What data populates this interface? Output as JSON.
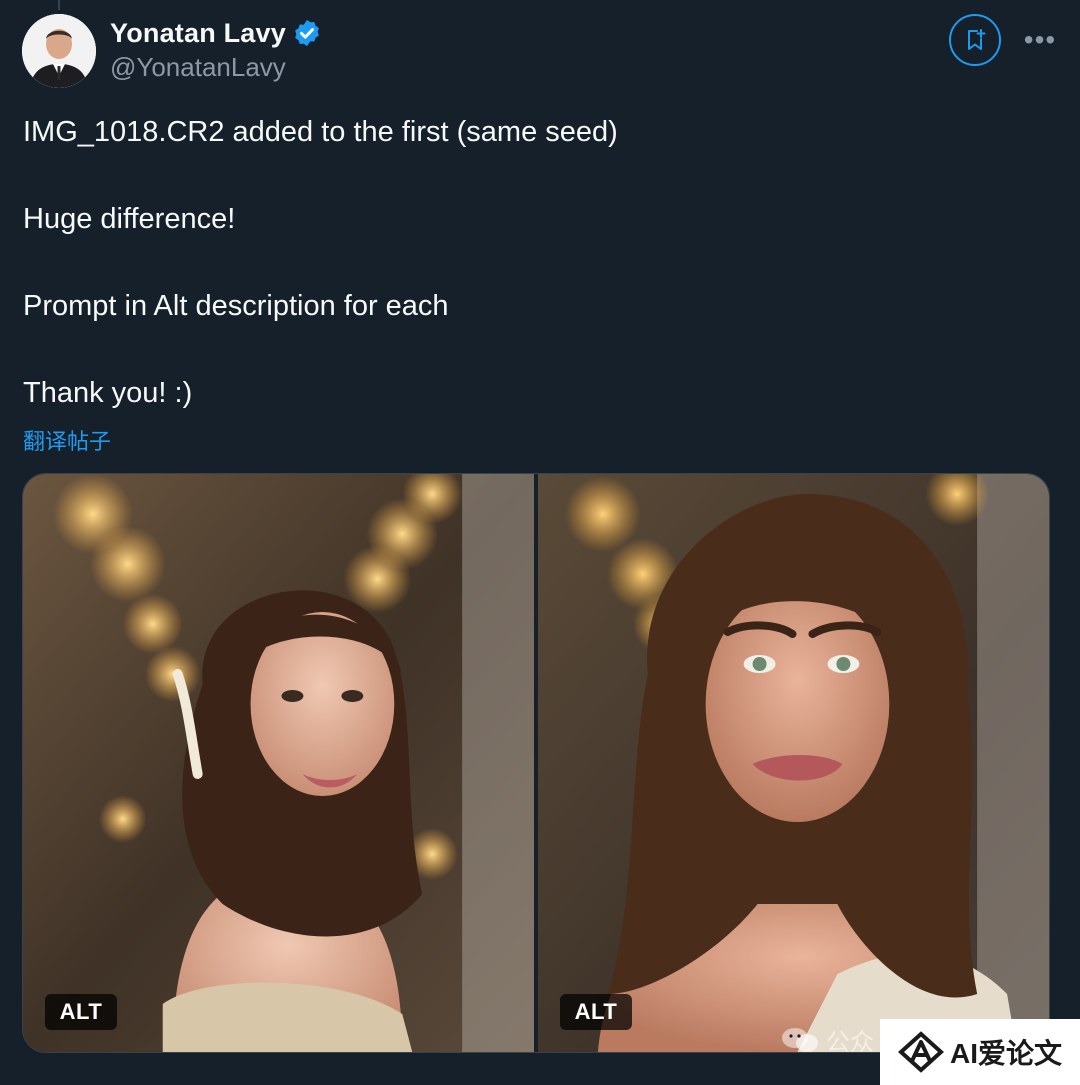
{
  "author": {
    "display_name": "Yonatan Lavy",
    "handle": "@YonatanLavy",
    "verified": true
  },
  "actions": {
    "subscribe_icon": "bookmark-plus-icon",
    "more_label": "•••"
  },
  "tweet": {
    "lines": [
      "IMG_1018.CR2 added to the first (same seed)",
      "Huge difference!",
      "Prompt in Alt description for each",
      "Thank you! :)"
    ],
    "translate_link": "翻译帖子"
  },
  "media": [
    {
      "alt_badge": "ALT"
    },
    {
      "alt_badge": "ALT"
    }
  ],
  "watermark": {
    "chat_text": "公众",
    "brand_text": "AI爱论文"
  },
  "colors": {
    "background": "#15202b",
    "accent": "#1d9bf0",
    "text": "#f7f9f9",
    "muted": "#8b98a5"
  }
}
